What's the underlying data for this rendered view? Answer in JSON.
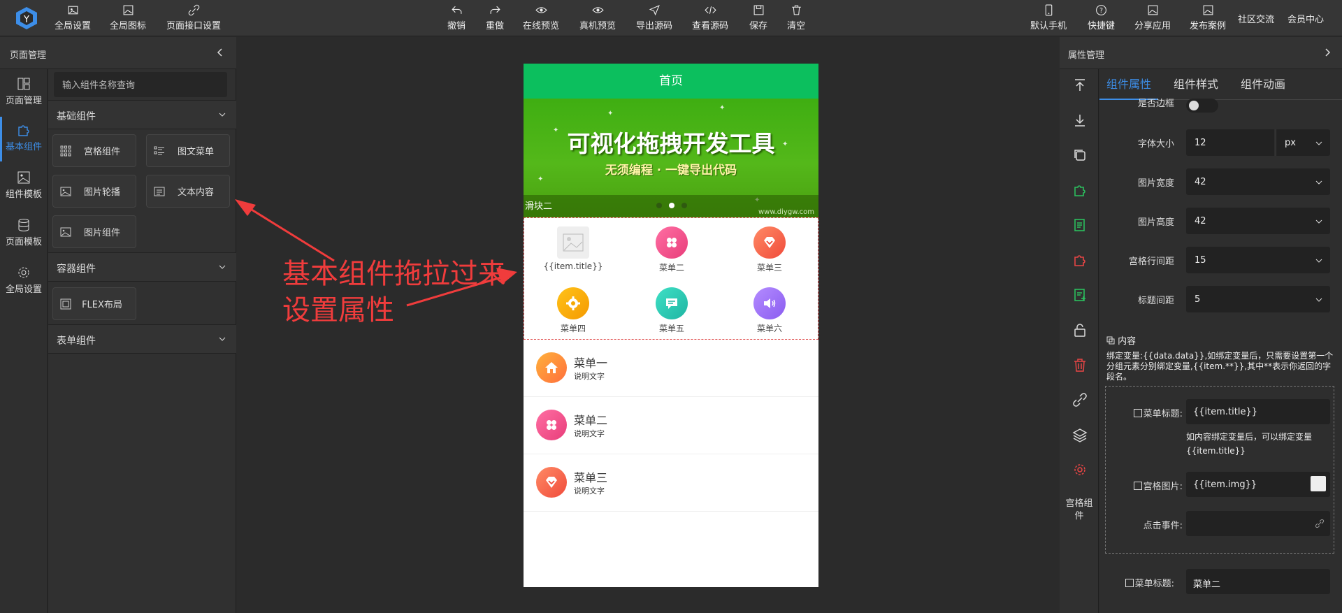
{
  "topbar": {
    "left": [
      "全局设置",
      "全局图标",
      "页面接口设置"
    ],
    "center": [
      "撤销",
      "重做",
      "在线预览",
      "真机预览",
      "导出源码",
      "查看源码",
      "保存",
      "清空"
    ],
    "right": [
      "默认手机",
      "快捷键",
      "分享应用",
      "发布案例",
      "社区交流",
      "会员中心"
    ]
  },
  "left_panel": {
    "title": "页面管理",
    "rail": [
      "页面管理",
      "基本组件",
      "组件模板",
      "页面模板",
      "全局设置"
    ],
    "search_placeholder": "输入组件名称查询",
    "sections": [
      "基础组件",
      "容器组件",
      "表单组件"
    ],
    "basic_components": [
      "宫格组件",
      "图文菜单",
      "图片轮播",
      "文本内容",
      "图片组件"
    ],
    "container_components": [
      "FLEX布局"
    ]
  },
  "annotation": {
    "line1": "基本组件拖拉过来",
    "line2": "设置属性"
  },
  "phone": {
    "title": "首页",
    "banner": {
      "headline": "可视化拖拽开发工具",
      "subline": "无须编程 · 一键导出代码",
      "caption": "滑块二",
      "url": "www.diygw.com"
    },
    "grid_items": [
      "{{item.title}}",
      "菜单二",
      "菜单三",
      "菜单四",
      "菜单五",
      "菜单六"
    ],
    "list_items": [
      {
        "title": "菜单一",
        "desc": "说明文字"
      },
      {
        "title": "菜单二",
        "desc": "说明文字"
      },
      {
        "title": "菜单三",
        "desc": "说明文字"
      }
    ]
  },
  "right_panel": {
    "title": "属性管理",
    "rail_label": "宫格组件",
    "tabs": [
      "组件属性",
      "组件样式",
      "组件动画"
    ],
    "props": {
      "border_label": "是否边框",
      "font_size_label": "字体大小",
      "font_size_value": "12",
      "font_unit": "px",
      "img_width_label": "图片宽度",
      "img_width_value": "42",
      "img_height_label": "图片高度",
      "img_height_value": "42",
      "row_gap_label": "宫格行间距",
      "row_gap_value": "15",
      "title_gap_label": "标题间距",
      "title_gap_value": "5"
    },
    "content": {
      "heading": "内容",
      "note": "绑定变量:{{data.data}},如绑定变量后，只需要设置第一个分组元素分别绑定变量,{{item.**}},其中**表示你返回的字段名。",
      "menu_title_label": "菜单标题:",
      "menu_title_value": "{{item.title}}",
      "menu_title_note": "如内容绑定变量后，可以绑定变量{{item.title}}",
      "grid_img_label": "宫格图片:",
      "grid_img_value": "{{item.img}}",
      "click_label": "点击事件:",
      "menu_title2_label": "菜单标题:",
      "menu_title2_value": "菜单二"
    }
  }
}
